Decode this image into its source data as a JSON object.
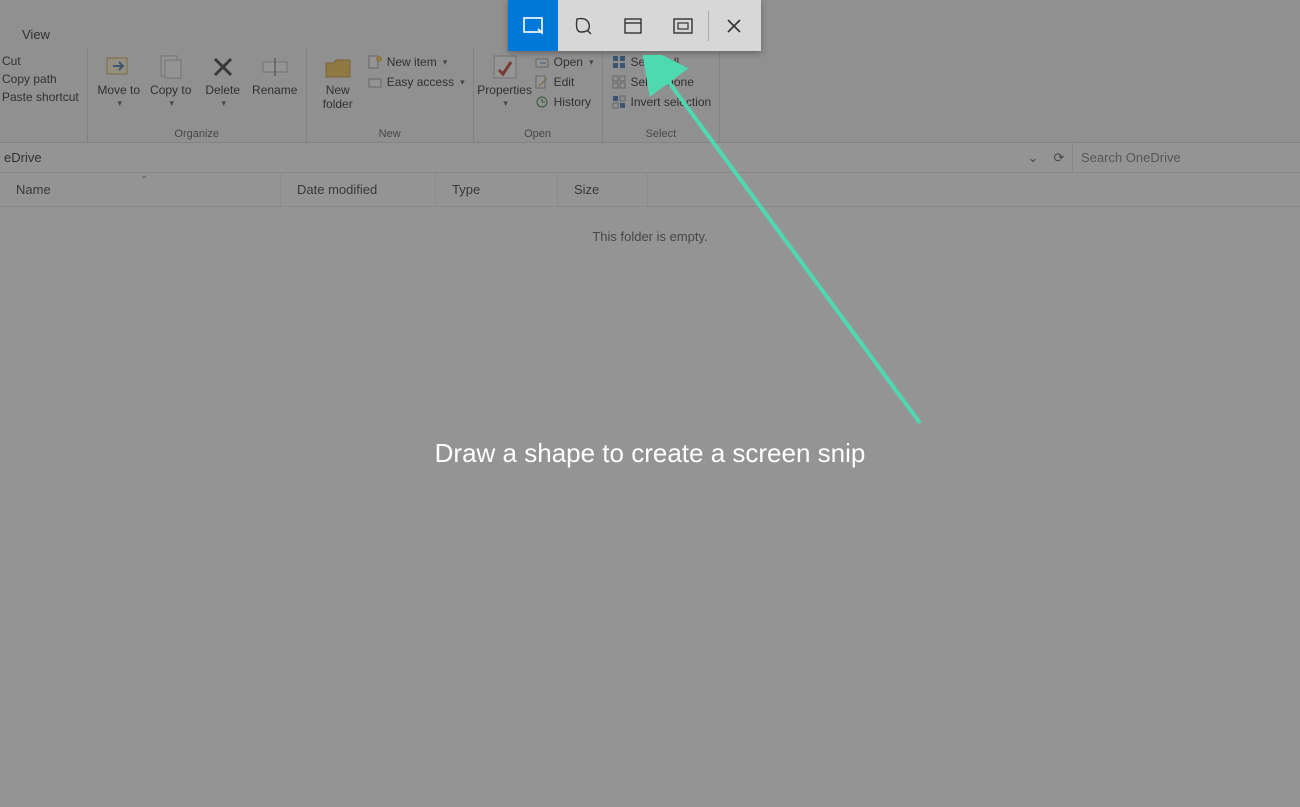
{
  "tabs": {
    "view": "View"
  },
  "ribbon": {
    "clipboard": {
      "cut": "Cut",
      "copy_path": "Copy path",
      "paste_shortcut": "Paste shortcut"
    },
    "organize": {
      "move_to": "Move to",
      "copy_to": "Copy to",
      "delete": "Delete",
      "rename": "Rename",
      "label": "Organize"
    },
    "new": {
      "new_folder": "New folder",
      "new_item": "New item",
      "easy_access": "Easy access",
      "label": "New"
    },
    "open": {
      "properties": "Properties",
      "open": "Open",
      "edit": "Edit",
      "history": "History",
      "label": "Open"
    },
    "select": {
      "select_all": "Select all",
      "select_none": "Select none",
      "invert": "Invert selection",
      "label": "Select"
    }
  },
  "address": {
    "location": "eDrive",
    "search_placeholder": "Search OneDrive"
  },
  "columns": {
    "name": "Name",
    "date": "Date modified",
    "type": "Type",
    "size": "Size"
  },
  "content": {
    "empty": "This folder is empty."
  },
  "snip": {
    "instruction": "Draw a shape to create a screen snip",
    "modes": {
      "rect": "Rectangular snip",
      "free": "Freeform snip",
      "window": "Window snip",
      "full": "Fullscreen snip",
      "close": "Close"
    }
  }
}
